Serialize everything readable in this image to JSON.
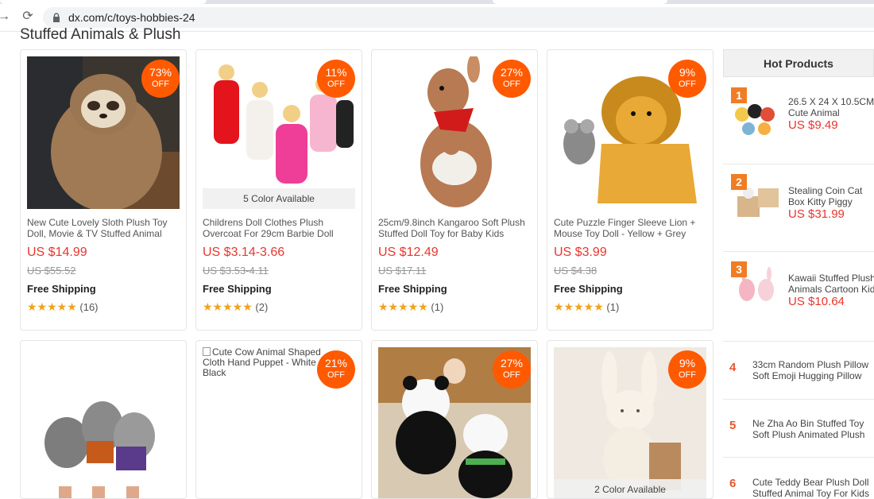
{
  "browser": {
    "url": "dx.com/c/toys-hobbies-24"
  },
  "section": {
    "title": "Stuffed Animals & Plush"
  },
  "products": [
    {
      "discount": "73%",
      "off": "OFF",
      "title": "New Cute Lovely Sloth Plush Toy Doll, Movie & TV Stuffed Animal",
      "price": "US $14.99",
      "old_price": "US $55.52",
      "shipping": "Free Shipping",
      "stars": "★★★★★",
      "reviews": "(16)"
    },
    {
      "discount": "11%",
      "off": "OFF",
      "color_available": "5 Color Available",
      "title": "Childrens Doll Clothes Plush Overcoat For 29cm Barbie Doll",
      "price": "US $3.14-3.66",
      "old_price": "US $3.53-4.11",
      "shipping": "Free Shipping",
      "stars": "★★★★★",
      "reviews": "(2)"
    },
    {
      "discount": "27%",
      "off": "OFF",
      "title": "25cm/9.8inch Kangaroo Soft Plush Stuffed Doll Toy for Baby Kids",
      "price": "US $12.49",
      "old_price": "US $17.11",
      "shipping": "Free Shipping",
      "stars": "★★★★★",
      "reviews": "(1)"
    },
    {
      "discount": "9%",
      "off": "OFF",
      "title": "Cute Puzzle Finger Sleeve Lion + Mouse Toy Doll - Yellow + Grey",
      "price": "US $3.99",
      "old_price": "US $4.38",
      "shipping": "Free Shipping",
      "stars": "★★★★★",
      "reviews": "(1)"
    },
    {},
    {
      "discount": "21%",
      "off": "OFF",
      "broken_alt": "Cute Cow Animal Shaped Cloth Hand Puppet - White + Black"
    },
    {
      "discount": "27%",
      "off": "OFF"
    },
    {
      "discount": "9%",
      "off": "OFF",
      "color_available": "2 Color Available"
    }
  ],
  "hot_products": {
    "heading": "Hot Products",
    "items": [
      {
        "rank": "1",
        "title_1": "26.5 X 24 X 10.5CM",
        "title_2": "Cute Animal",
        "price": "US $9.49"
      },
      {
        "rank": "2",
        "title_1": "Stealing Coin Cat",
        "title_2": "Box Kitty Piggy",
        "price": "US $31.99"
      },
      {
        "rank": "3",
        "title_1": "Kawaii Stuffed Plush",
        "title_2": "Animals Cartoon Kid",
        "price": "US $10.64"
      },
      {
        "rank": "4",
        "title_1": "33cm Random Plush Pillow",
        "title_2": "Soft Emoji Hugging Pillow"
      },
      {
        "rank": "5",
        "title_1": "Ne Zha Ao Bin Stuffed Toy",
        "title_2": "Soft Plush Animated Plush"
      },
      {
        "rank": "6",
        "title_1": "Cute Teddy Bear Plush Doll",
        "title_2": "Stuffed Animal Toy For Kids"
      }
    ]
  }
}
